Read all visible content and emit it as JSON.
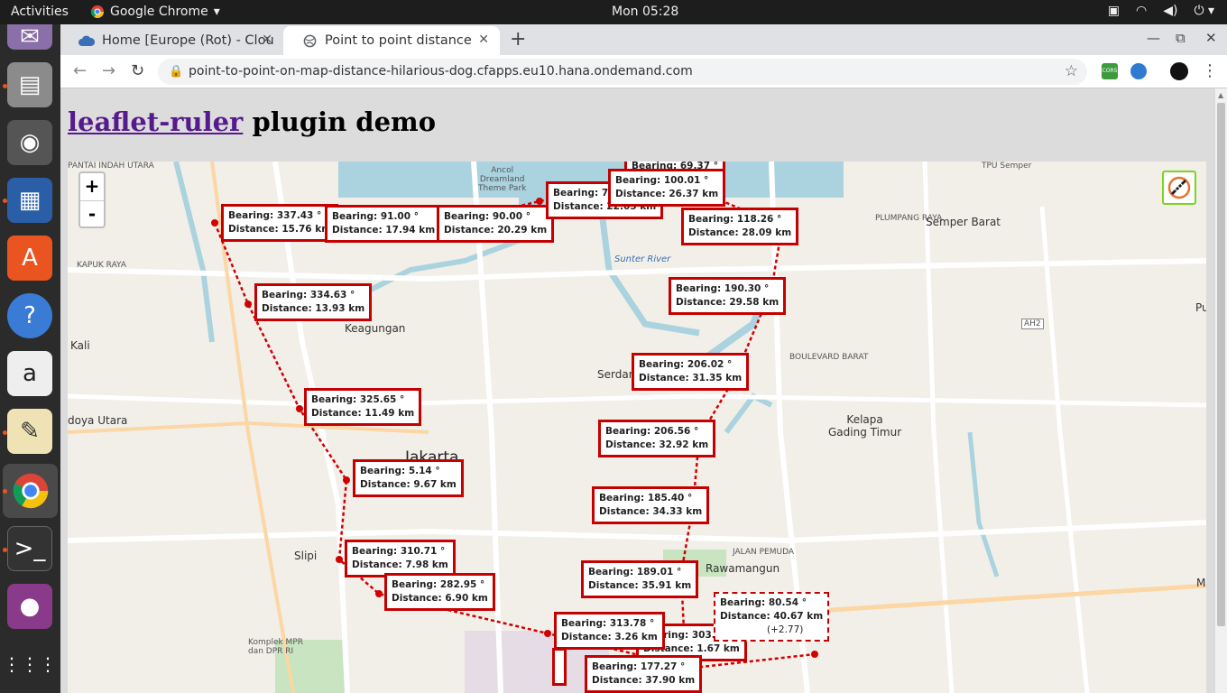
{
  "system": {
    "activities": "Activities",
    "app_name": "Google Chrome",
    "clock": "Mon 05:28"
  },
  "browser": {
    "tabs": [
      {
        "title": "Home [Europe (Rot) - Clou"
      },
      {
        "title": "Point to point distance"
      }
    ],
    "url": "point-to-point-on-map-distance-hilarious-dog.cfapps.eu10.hana.ondemand.com",
    "ext_label": "CORS"
  },
  "page": {
    "heading_link": "leaflet-ruler",
    "heading_rest": " plugin demo"
  },
  "map": {
    "zoom_in": "+",
    "zoom_out": "-",
    "places": [
      {
        "name": "Jakarta"
      },
      {
        "name": "Keagungan"
      },
      {
        "name": "Serdang"
      },
      {
        "name": "Kelapa\nGading Timur"
      },
      {
        "name": "Semper Barat"
      },
      {
        "name": "Rawamangun"
      },
      {
        "name": "Slipi"
      },
      {
        "name": "Kali"
      },
      {
        "name": "doya Utara"
      },
      {
        "name": "KAPUK RAYA"
      },
      {
        "name": "Ancol\nDreamland\nTheme Park"
      },
      {
        "name": "Sunter River"
      },
      {
        "name": "Komplek MPR\ndan DPR RI"
      },
      {
        "name": "PANTAI INDAH UTARA"
      },
      {
        "name": "BOULEVARD BARAT"
      },
      {
        "name": "JALAN PEMUDA"
      },
      {
        "name": "TPU Semper"
      },
      {
        "name": "PLUMPANG RAYA"
      },
      {
        "name": "Pu"
      },
      {
        "name": "Me"
      },
      {
        "name": "AH2"
      }
    ],
    "measurements": [
      {
        "bearing": "Bearing: 337.43 °",
        "distance": "Distance: 15.76 km"
      },
      {
        "bearing": "Bearing: 91.00 °",
        "distance": "Distance: 17.94 km"
      },
      {
        "bearing": "Bearing: 90.00 °",
        "distance": "Distance: 20.29 km"
      },
      {
        "bearing": "Bearing: 78.0",
        "distance": "Distance: 22.05 km"
      },
      {
        "bearing": "Bearing: 69.37 °",
        "distance": ""
      },
      {
        "bearing": "Bearing: 100.01 °",
        "distance": "Distance: 26.37 km"
      },
      {
        "bearing": "Bearing: 118.26 °",
        "distance": "Distance: 28.09 km"
      },
      {
        "bearing": "Bearing: 334.63 °",
        "distance": "Distance: 13.93 km"
      },
      {
        "bearing": "Bearing: 190.30 °",
        "distance": "Distance: 29.58 km"
      },
      {
        "bearing": "Bearing: 206.02 °",
        "distance": "Distance: 31.35 km"
      },
      {
        "bearing": "Bearing: 325.65 °",
        "distance": "Distance: 11.49 km"
      },
      {
        "bearing": "Bearing: 206.56 °",
        "distance": "Distance: 32.92 km"
      },
      {
        "bearing": "Bearing: 5.14 °",
        "distance": "Distance: 9.67 km"
      },
      {
        "bearing": "Bearing: 185.40 °",
        "distance": "Distance: 34.33 km"
      },
      {
        "bearing": "Bearing: 310.71 °",
        "distance": "Distance: 7.98 km"
      },
      {
        "bearing": "Bearing: 189.01 °",
        "distance": "Distance: 35.91 km"
      },
      {
        "bearing": "Bearing: 282.95 °",
        "distance": "Distance: 6.90 km"
      },
      {
        "bearing": "Bearing: 313.78 °",
        "distance": "Distance: 3.26 km"
      },
      {
        "bearing": "Bearing: 303.69 °",
        "distance": "Distance: 1.67 km"
      },
      {
        "bearing": "Bearing: 177.27 °",
        "distance": "Distance: 37.90 km"
      }
    ],
    "live_measurement": {
      "bearing": "Bearing: 80.54 °",
      "distance": "Distance: 40.67 km",
      "extra": "(+2.77)"
    }
  }
}
